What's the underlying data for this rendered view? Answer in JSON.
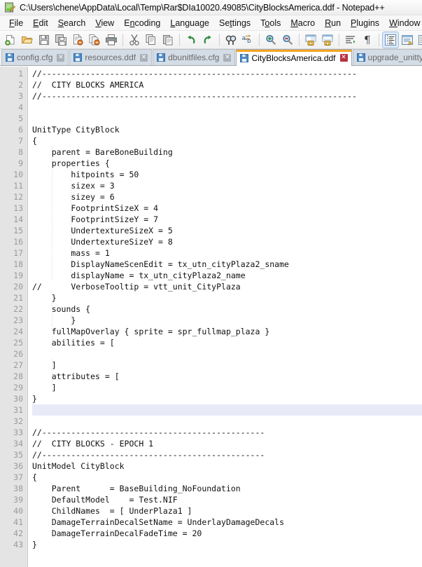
{
  "window": {
    "title": "C:\\Users\\chene\\AppData\\Local\\Temp\\Rar$DIa10020.49085\\CityBlocksAmerica.ddf - Notepad++",
    "app_icon": "notepad-plus-plus-icon"
  },
  "menubar": {
    "items": [
      {
        "label": "File",
        "accel_index": 0
      },
      {
        "label": "Edit",
        "accel_index": 0
      },
      {
        "label": "Search",
        "accel_index": 0
      },
      {
        "label": "View",
        "accel_index": 0
      },
      {
        "label": "Encoding",
        "accel_index": 1
      },
      {
        "label": "Language",
        "accel_index": 0
      },
      {
        "label": "Settings",
        "accel_index": 2
      },
      {
        "label": "Tools",
        "accel_index": 1
      },
      {
        "label": "Macro",
        "accel_index": 0
      },
      {
        "label": "Run",
        "accel_index": 0
      },
      {
        "label": "Plugins",
        "accel_index": 0
      },
      {
        "label": "Window",
        "accel_index": 0
      },
      {
        "label": "?",
        "accel_index": -1
      }
    ]
  },
  "toolbar": {
    "buttons": [
      {
        "name": "new-file-icon",
        "group": 0,
        "active": false
      },
      {
        "name": "open-file-icon",
        "group": 0,
        "active": false
      },
      {
        "name": "save-icon",
        "group": 0,
        "active": false
      },
      {
        "name": "save-all-icon",
        "group": 0,
        "active": false
      },
      {
        "name": "close-document-icon",
        "group": 0,
        "active": false
      },
      {
        "name": "close-all-documents-icon",
        "group": 0,
        "active": false
      },
      {
        "name": "print-icon",
        "group": 0,
        "active": false
      },
      {
        "name": "cut-icon",
        "group": 1,
        "active": false
      },
      {
        "name": "copy-icon",
        "group": 1,
        "active": false
      },
      {
        "name": "paste-icon",
        "group": 1,
        "active": false
      },
      {
        "name": "undo-icon",
        "group": 2,
        "active": false
      },
      {
        "name": "redo-icon",
        "group": 2,
        "active": false
      },
      {
        "name": "find-icon",
        "group": 3,
        "active": false
      },
      {
        "name": "replace-icon",
        "group": 3,
        "active": false
      },
      {
        "name": "zoom-in-icon",
        "group": 4,
        "active": false
      },
      {
        "name": "zoom-out-icon",
        "group": 4,
        "active": false
      },
      {
        "name": "sync-vertical-scroll-icon",
        "group": 5,
        "active": false
      },
      {
        "name": "sync-horizontal-scroll-icon",
        "group": 5,
        "active": false
      },
      {
        "name": "word-wrap-icon",
        "group": 6,
        "active": false
      },
      {
        "name": "show-all-characters-icon",
        "group": 6,
        "active": false
      },
      {
        "name": "indent-guide-icon",
        "group": 7,
        "active": true
      },
      {
        "name": "user-defined-dialog-icon",
        "group": 7,
        "active": false
      },
      {
        "name": "document-map-icon",
        "group": 7,
        "active": false
      },
      {
        "name": "function-list-icon",
        "group": 7,
        "active": false
      }
    ]
  },
  "tabs": [
    {
      "label": "config.cfg",
      "active": false,
      "icon": "floppy-disk-icon",
      "close": "close-tab-icon"
    },
    {
      "label": "resources.ddf",
      "active": false,
      "icon": "floppy-disk-icon",
      "close": "close-tab-icon"
    },
    {
      "label": "dbunitfiles.cfg",
      "active": false,
      "icon": "floppy-disk-icon",
      "close": "close-tab-icon"
    },
    {
      "label": "CityBlocksAmerica.ddf",
      "active": true,
      "icon": "floppy-disk-icon",
      "close": "close-tab-icon"
    },
    {
      "label": "upgrade_unittypes.csv",
      "active": false,
      "icon": "floppy-disk-icon",
      "close": "close-tab-icon"
    }
  ],
  "editor": {
    "current_line": 31,
    "first_line_number": 1,
    "lines": [
      "//-----------------------------------------------------------------",
      "//  CITY BLOCKS AMERICA",
      "//-----------------------------------------------------------------",
      "",
      "",
      "UnitType CityBlock",
      "{",
      "    parent = BareBoneBuilding",
      "    properties {",
      "        hitpoints = 50",
      "        sizex = 3",
      "        sizey = 6",
      "        FootprintSizeX = 4",
      "        FootprintSizeY = 7",
      "        UndertextureSizeX = 5",
      "        UndertextureSizeY = 8",
      "        mass = 1",
      "        DisplayNameScenEdit = tx_utn_cityPlaza2_sname",
      "        displayName = tx_utn_cityPlaza2_name",
      "//      VerboseTooltip = vtt_unit_CityPlaza",
      "    }",
      "    sounds {",
      "        }",
      "    fullMapOverlay { sprite = spr_fullmap_plaza }",
      "    abilities = [",
      "",
      "    ]",
      "    attributes = [",
      "    ]",
      "}",
      "",
      "",
      "//----------------------------------------------",
      "//  CITY BLOCKS - EPOCH 1",
      "//----------------------------------------------",
      "UnitModel CityBlock",
      "{",
      "    Parent      = BaseBuilding_NoFoundation",
      "    DefaultModel    = Test.NIF",
      "    ChildNames  = [ UnderPlaza1 ]",
      "    DamageTerrainDecalSetName = UnderlayDamageDecals",
      "    DamageTerrainDecalFadeTime = 20",
      "}"
    ]
  },
  "colors": {
    "active_tab_accent": "#f5a623",
    "current_line_highlight": "#e8eaf8",
    "gutter_bg": "#e4e4e4",
    "line_number_fg": "#9a9a9a",
    "code_fg": "#111111",
    "inactive_tab_bg": "#d4dce5",
    "close_active": "#b4343f"
  }
}
